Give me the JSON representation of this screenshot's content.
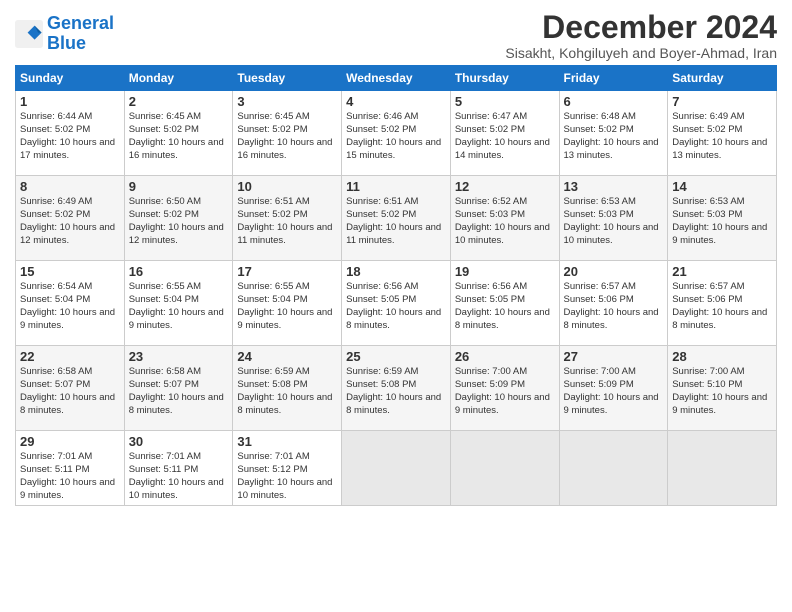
{
  "logo": {
    "line1": "General",
    "line2": "Blue"
  },
  "title": "December 2024",
  "subtitle": "Sisakht, Kohgiluyeh and Boyer-Ahmad, Iran",
  "headers": [
    "Sunday",
    "Monday",
    "Tuesday",
    "Wednesday",
    "Thursday",
    "Friday",
    "Saturday"
  ],
  "weeks": [
    [
      {
        "day": "1",
        "sunrise": "6:44 AM",
        "sunset": "5:02 PM",
        "daylight": "10 hours and 17 minutes."
      },
      {
        "day": "2",
        "sunrise": "6:45 AM",
        "sunset": "5:02 PM",
        "daylight": "10 hours and 16 minutes."
      },
      {
        "day": "3",
        "sunrise": "6:45 AM",
        "sunset": "5:02 PM",
        "daylight": "10 hours and 16 minutes."
      },
      {
        "day": "4",
        "sunrise": "6:46 AM",
        "sunset": "5:02 PM",
        "daylight": "10 hours and 15 minutes."
      },
      {
        "day": "5",
        "sunrise": "6:47 AM",
        "sunset": "5:02 PM",
        "daylight": "10 hours and 14 minutes."
      },
      {
        "day": "6",
        "sunrise": "6:48 AM",
        "sunset": "5:02 PM",
        "daylight": "10 hours and 13 minutes."
      },
      {
        "day": "7",
        "sunrise": "6:49 AM",
        "sunset": "5:02 PM",
        "daylight": "10 hours and 13 minutes."
      }
    ],
    [
      {
        "day": "8",
        "sunrise": "6:49 AM",
        "sunset": "5:02 PM",
        "daylight": "10 hours and 12 minutes."
      },
      {
        "day": "9",
        "sunrise": "6:50 AM",
        "sunset": "5:02 PM",
        "daylight": "10 hours and 12 minutes."
      },
      {
        "day": "10",
        "sunrise": "6:51 AM",
        "sunset": "5:02 PM",
        "daylight": "10 hours and 11 minutes."
      },
      {
        "day": "11",
        "sunrise": "6:51 AM",
        "sunset": "5:02 PM",
        "daylight": "10 hours and 11 minutes."
      },
      {
        "day": "12",
        "sunrise": "6:52 AM",
        "sunset": "5:03 PM",
        "daylight": "10 hours and 10 minutes."
      },
      {
        "day": "13",
        "sunrise": "6:53 AM",
        "sunset": "5:03 PM",
        "daylight": "10 hours and 10 minutes."
      },
      {
        "day": "14",
        "sunrise": "6:53 AM",
        "sunset": "5:03 PM",
        "daylight": "10 hours and 9 minutes."
      }
    ],
    [
      {
        "day": "15",
        "sunrise": "6:54 AM",
        "sunset": "5:04 PM",
        "daylight": "10 hours and 9 minutes."
      },
      {
        "day": "16",
        "sunrise": "6:55 AM",
        "sunset": "5:04 PM",
        "daylight": "10 hours and 9 minutes."
      },
      {
        "day": "17",
        "sunrise": "6:55 AM",
        "sunset": "5:04 PM",
        "daylight": "10 hours and 9 minutes."
      },
      {
        "day": "18",
        "sunrise": "6:56 AM",
        "sunset": "5:05 PM",
        "daylight": "10 hours and 8 minutes."
      },
      {
        "day": "19",
        "sunrise": "6:56 AM",
        "sunset": "5:05 PM",
        "daylight": "10 hours and 8 minutes."
      },
      {
        "day": "20",
        "sunrise": "6:57 AM",
        "sunset": "5:06 PM",
        "daylight": "10 hours and 8 minutes."
      },
      {
        "day": "21",
        "sunrise": "6:57 AM",
        "sunset": "5:06 PM",
        "daylight": "10 hours and 8 minutes."
      }
    ],
    [
      {
        "day": "22",
        "sunrise": "6:58 AM",
        "sunset": "5:07 PM",
        "daylight": "10 hours and 8 minutes."
      },
      {
        "day": "23",
        "sunrise": "6:58 AM",
        "sunset": "5:07 PM",
        "daylight": "10 hours and 8 minutes."
      },
      {
        "day": "24",
        "sunrise": "6:59 AM",
        "sunset": "5:08 PM",
        "daylight": "10 hours and 8 minutes."
      },
      {
        "day": "25",
        "sunrise": "6:59 AM",
        "sunset": "5:08 PM",
        "daylight": "10 hours and 8 minutes."
      },
      {
        "day": "26",
        "sunrise": "7:00 AM",
        "sunset": "5:09 PM",
        "daylight": "10 hours and 9 minutes."
      },
      {
        "day": "27",
        "sunrise": "7:00 AM",
        "sunset": "5:09 PM",
        "daylight": "10 hours and 9 minutes."
      },
      {
        "day": "28",
        "sunrise": "7:00 AM",
        "sunset": "5:10 PM",
        "daylight": "10 hours and 9 minutes."
      }
    ],
    [
      {
        "day": "29",
        "sunrise": "7:01 AM",
        "sunset": "5:11 PM",
        "daylight": "10 hours and 9 minutes."
      },
      {
        "day": "30",
        "sunrise": "7:01 AM",
        "sunset": "5:11 PM",
        "daylight": "10 hours and 10 minutes."
      },
      {
        "day": "31",
        "sunrise": "7:01 AM",
        "sunset": "5:12 PM",
        "daylight": "10 hours and 10 minutes."
      },
      null,
      null,
      null,
      null
    ]
  ]
}
